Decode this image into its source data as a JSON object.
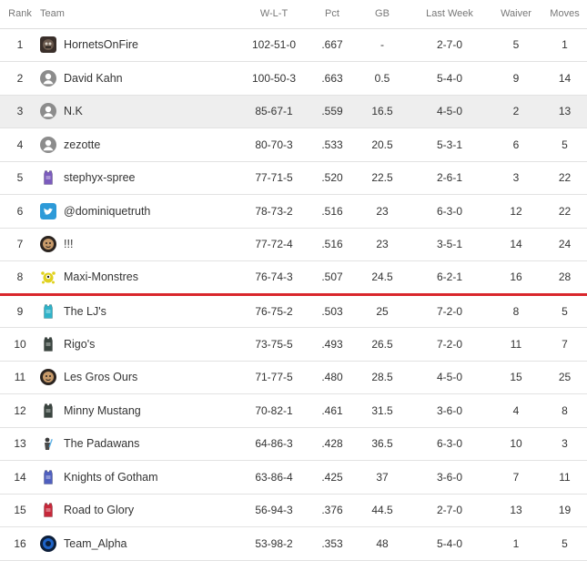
{
  "columns": {
    "rank": "Rank",
    "team": "Team",
    "wlt": "W-L-T",
    "pct": "Pct",
    "gb": "GB",
    "last_week": "Last Week",
    "waiver": "Waiver",
    "moves": "Moves"
  },
  "colors": {
    "cutoff_line": "#d9262c",
    "highlight_row": "#eeeeee"
  },
  "teams": [
    {
      "rank": "1",
      "name": "HornetsOnFire",
      "icon": "hornet-avatar-icon",
      "wlt": "102-51-0",
      "pct": ".667",
      "gb": "-",
      "last_week": "2-7-0",
      "waiver": "5",
      "moves": "1"
    },
    {
      "rank": "2",
      "name": "David Kahn",
      "icon": "default-user-icon",
      "wlt": "100-50-3",
      "pct": ".663",
      "gb": "0.5",
      "last_week": "5-4-0",
      "waiver": "9",
      "moves": "14"
    },
    {
      "rank": "3",
      "name": "N.K",
      "icon": "default-user-icon",
      "wlt": "85-67-1",
      "pct": ".559",
      "gb": "16.5",
      "last_week": "4-5-0",
      "waiver": "2",
      "moves": "13"
    },
    {
      "rank": "4",
      "name": "zezotte",
      "icon": "default-user-icon",
      "wlt": "80-70-3",
      "pct": ".533",
      "gb": "20.5",
      "last_week": "5-3-1",
      "waiver": "6",
      "moves": "5"
    },
    {
      "rank": "5",
      "name": "stephyx-spree",
      "icon": "purple-jersey-icon",
      "wlt": "77-71-5",
      "pct": ".520",
      "gb": "22.5",
      "last_week": "2-6-1",
      "waiver": "3",
      "moves": "22"
    },
    {
      "rank": "6",
      "name": "@dominiquetruth",
      "icon": "twitter-bird-icon",
      "wlt": "78-73-2",
      "pct": ".516",
      "gb": "23",
      "last_week": "6-3-0",
      "waiver": "12",
      "moves": "22"
    },
    {
      "rank": "7",
      "name": "!!!",
      "icon": "photo-avatar-icon",
      "wlt": "77-72-4",
      "pct": ".516",
      "gb": "23",
      "last_week": "3-5-1",
      "waiver": "14",
      "moves": "24"
    },
    {
      "rank": "8",
      "name": "Maxi-Monstres",
      "icon": "yellow-monster-icon",
      "wlt": "76-74-3",
      "pct": ".507",
      "gb": "24.5",
      "last_week": "6-2-1",
      "waiver": "16",
      "moves": "28"
    },
    {
      "rank": "9",
      "name": "The LJ's",
      "icon": "teal-jersey-icon",
      "wlt": "76-75-2",
      "pct": ".503",
      "gb": "25",
      "last_week": "7-2-0",
      "waiver": "8",
      "moves": "5"
    },
    {
      "rank": "10",
      "name": "Rigo's",
      "icon": "dark-jersey-icon",
      "wlt": "73-75-5",
      "pct": ".493",
      "gb": "26.5",
      "last_week": "7-2-0",
      "waiver": "11",
      "moves": "7"
    },
    {
      "rank": "11",
      "name": "Les Gros Ours",
      "icon": "photo-avatar-icon",
      "wlt": "71-77-5",
      "pct": ".480",
      "gb": "28.5",
      "last_week": "4-5-0",
      "waiver": "15",
      "moves": "25"
    },
    {
      "rank": "12",
      "name": "Minny Mustang",
      "icon": "dark-jersey-icon",
      "wlt": "70-82-1",
      "pct": ".461",
      "gb": "31.5",
      "last_week": "3-6-0",
      "waiver": "4",
      "moves": "8"
    },
    {
      "rank": "13",
      "name": "The Padawans",
      "icon": "starwars-figure-icon",
      "wlt": "64-86-3",
      "pct": ".428",
      "gb": "36.5",
      "last_week": "6-3-0",
      "waiver": "10",
      "moves": "3"
    },
    {
      "rank": "14",
      "name": "Knights of Gotham",
      "icon": "blue-jersey-icon",
      "wlt": "63-86-4",
      "pct": ".425",
      "gb": "37",
      "last_week": "3-6-0",
      "waiver": "7",
      "moves": "11"
    },
    {
      "rank": "15",
      "name": "Road to Glory",
      "icon": "red-jersey-icon",
      "wlt": "56-94-3",
      "pct": ".376",
      "gb": "44.5",
      "last_week": "2-7-0",
      "waiver": "13",
      "moves": "19"
    },
    {
      "rank": "16",
      "name": "Team_Alpha",
      "icon": "blue-round-logo-icon",
      "wlt": "53-98-2",
      "pct": ".353",
      "gb": "48",
      "last_week": "5-4-0",
      "waiver": "1",
      "moves": "5"
    }
  ]
}
